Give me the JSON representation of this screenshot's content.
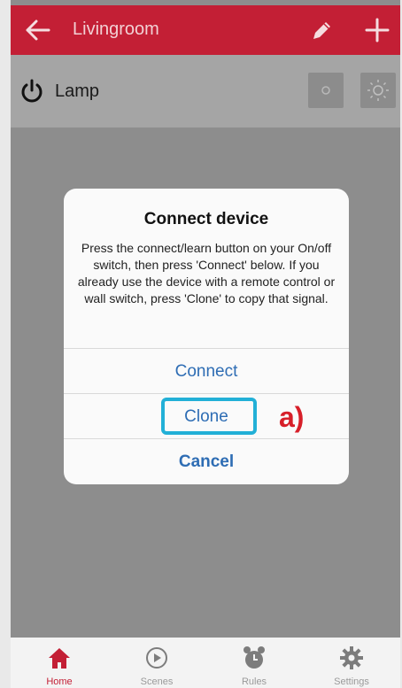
{
  "header": {
    "title": "Livingroom",
    "back_icon": "arrow-left-icon",
    "edit_icon": "pencil-icon",
    "add_icon": "plus-icon"
  },
  "device": {
    "name": "Lamp",
    "power_icon": "power-icon",
    "off_icon": "circle-icon",
    "on_icon": "sun-icon"
  },
  "dialog": {
    "title": "Connect device",
    "message": "Press the connect/learn button on your On/off switch, then press 'Connect' below. If you already use the device with a remote control or wall switch, press 'Clone' to copy that signal.",
    "connect_label": "Connect",
    "clone_label": "Clone",
    "cancel_label": "Cancel"
  },
  "annotation": {
    "label": "a)",
    "color": "#d71f29",
    "highlight_color": "#22b0d7"
  },
  "tabs": [
    {
      "label": "Home",
      "icon": "home-icon",
      "active": true
    },
    {
      "label": "Scenes",
      "icon": "play-icon",
      "active": false
    },
    {
      "label": "Rules",
      "icon": "alarm-clock-icon",
      "active": false
    },
    {
      "label": "Settings",
      "icon": "gear-icon",
      "active": false
    }
  ],
  "colors": {
    "accent": "#c31f35",
    "link": "#2e6db4"
  }
}
